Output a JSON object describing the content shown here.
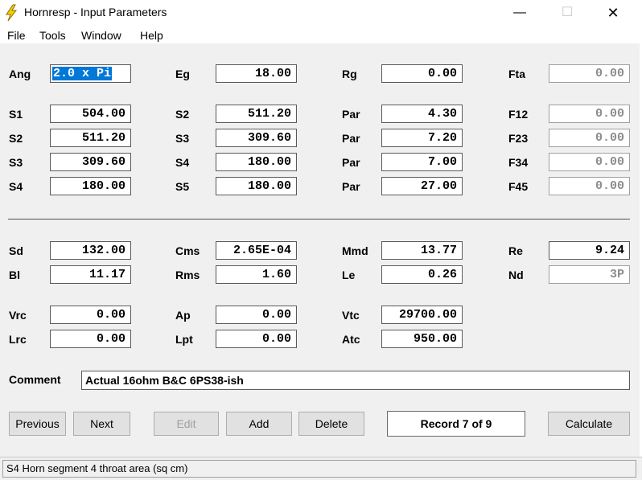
{
  "window": {
    "title": "Hornresp - Input Parameters",
    "minimize": "—",
    "maximize": "☐",
    "close": "✕",
    "accent": "#0078d7"
  },
  "menu": [
    "File",
    "Tools",
    "Window",
    "Help"
  ],
  "fields": {
    "Ang": "2.0 x Pi",
    "Eg": "18.00",
    "Rg": "0.00",
    "Fta": "0.00",
    "S1": "504.00",
    "S2_b": "511.20",
    "Par1": "4.30",
    "F12": "0.00",
    "S2": "511.20",
    "S3_b": "309.60",
    "Par2": "7.20",
    "F23": "0.00",
    "S3": "309.60",
    "S4_b": "180.00",
    "Par3": "7.00",
    "F34": "0.00",
    "S4": "180.00",
    "S5": "180.00",
    "Par4": "27.00",
    "F45": "0.00",
    "Sd": "132.00",
    "Cms": "2.65E-04",
    "Mmd": "13.77",
    "Re": "9.24",
    "Bl": "11.17",
    "Rms": "1.60",
    "Le": "0.26",
    "Nd": "3P",
    "Vrc": "0.00",
    "Ap": "0.00",
    "Vtc": "29700.00",
    "Lrc": "0.00",
    "Lpt": "0.00",
    "Atc": "950.00"
  },
  "labels": {
    "Ang": "Ang",
    "Eg": "Eg",
    "Rg": "Rg",
    "Fta": "Fta",
    "S1": "S1",
    "S2": "S2",
    "S3": "S3",
    "S4": "S4",
    "S5": "S5",
    "Par": "Par",
    "F12": "F12",
    "F23": "F23",
    "F34": "F34",
    "F45": "F45",
    "Sd": "Sd",
    "Cms": "Cms",
    "Mmd": "Mmd",
    "Re": "Re",
    "Bl": "Bl",
    "Rms": "Rms",
    "Le": "Le",
    "Nd": "Nd",
    "Vrc": "Vrc",
    "Ap": "Ap",
    "Vtc": "Vtc",
    "Lrc": "Lrc",
    "Lpt": "Lpt",
    "Atc": "Atc",
    "Comment": "Comment"
  },
  "comment": "Actual 16ohm B&C 6PS38-ish",
  "buttons": {
    "previous": "Previous",
    "next": "Next",
    "edit": "Edit",
    "add": "Add",
    "delete": "Delete",
    "calculate": "Calculate"
  },
  "record": "Record 7 of 9",
  "status": "S4   Horn segment 4 throat area  (sq cm)"
}
